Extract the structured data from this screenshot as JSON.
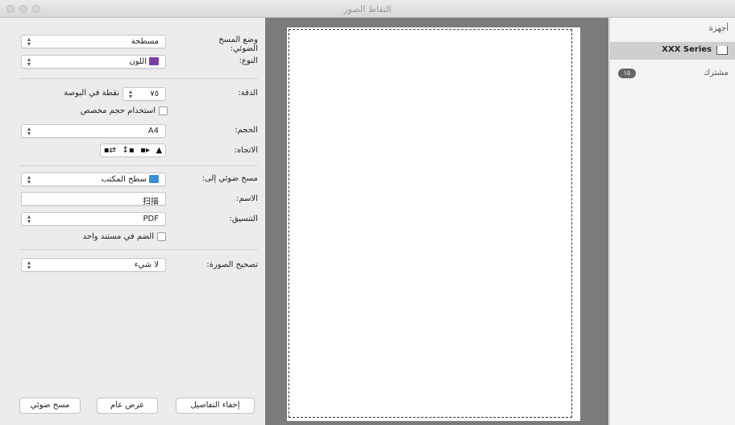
{
  "window": {
    "title": "التقاط الصور"
  },
  "options": {
    "scan_mode": {
      "label": "وضع المسح الضوئي:",
      "value": "مسطحة"
    },
    "type": {
      "label": "النوع:",
      "value": "اللون",
      "swatch": "#7a3fa6"
    },
    "resolution": {
      "label": "الدقة:",
      "value": "٧٥",
      "unit": "نقطة في البوصة"
    },
    "custom_size": {
      "label": "استخدام حجم مخصص"
    },
    "size": {
      "label": "الحجم:",
      "value": "A4"
    },
    "orientation": {
      "label": "الاتجاه:",
      "icons": [
        "▪⇄",
        "↕▪",
        "▪▸",
        "▲"
      ]
    },
    "scan_to": {
      "label": "مسح ضوئي إلى:",
      "value": "سطح المكتب",
      "swatch": "#3a8fd6"
    },
    "name": {
      "label": "الاسم:",
      "value": "扫描"
    },
    "format": {
      "label": "التنسيق:",
      "value": "PDF"
    },
    "combine": {
      "label": "الضم في مستند واحد"
    },
    "image_correction": {
      "label": "تصحيح الصورة:",
      "value": "لا شيء"
    }
  },
  "buttons": {
    "hide_details": "إخفاء التفاصيل",
    "overview": "عرض عام",
    "scan": "مسح ضوئي"
  },
  "devices": {
    "section_title": "أجهزة",
    "device_name": "XXX Series",
    "shared_title": "مشترك",
    "shared_count": "١٥"
  }
}
